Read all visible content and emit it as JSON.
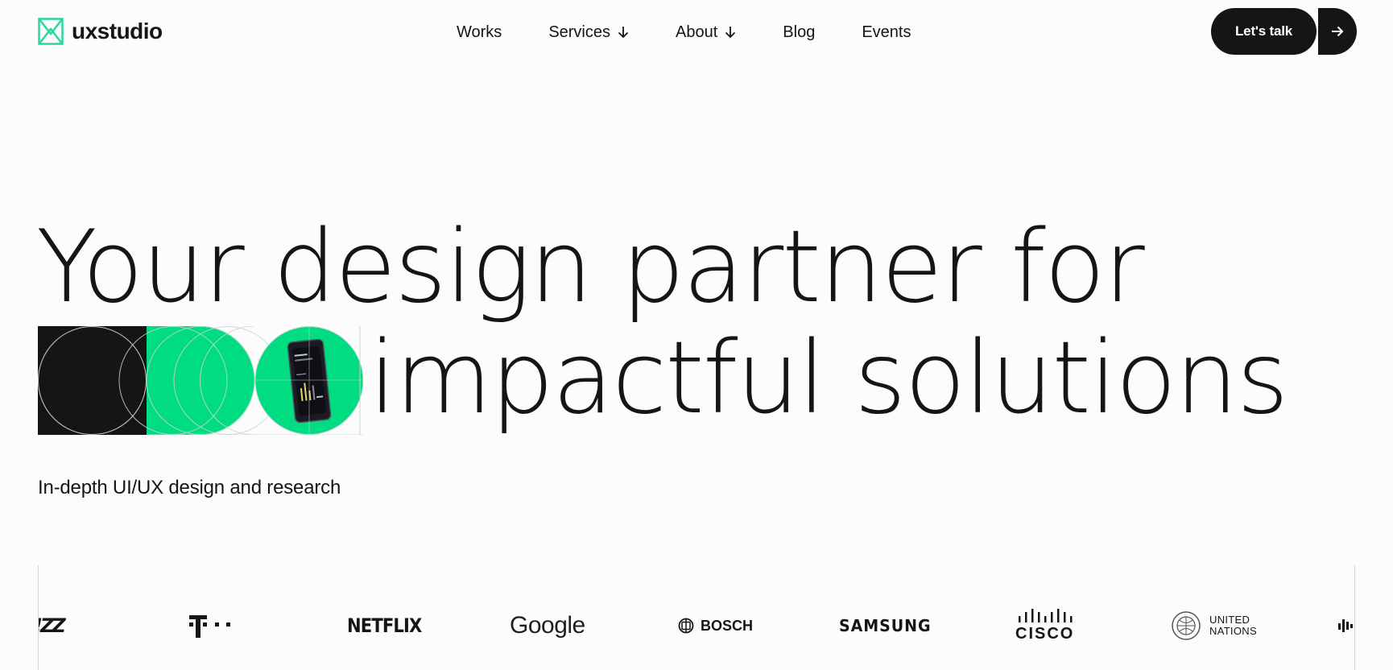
{
  "brand": {
    "name": "uxstudio",
    "accent": "#00dc82",
    "dark": "#151417"
  },
  "nav": {
    "items": [
      {
        "label": "Works",
        "has_dropdown": false
      },
      {
        "label": "Services",
        "has_dropdown": true
      },
      {
        "label": "About",
        "has_dropdown": true
      },
      {
        "label": "Blog",
        "has_dropdown": false
      },
      {
        "label": "Events",
        "has_dropdown": false
      }
    ]
  },
  "cta": {
    "label": "Let's talk",
    "icon": "arrow-right-icon"
  },
  "hero": {
    "line1": "Your design partner for",
    "line2": "impactful solutions",
    "subtitle": "In-depth UI/UX design and research"
  },
  "clients": {
    "partial_left": "!ZZ",
    "telekom": "T · · ·",
    "netflix": "NETFLIX",
    "google": "Google",
    "bosch": "BOSCH",
    "samsung": "SAMSUNG",
    "cisco": "CISCO",
    "un_line1": "UNITED",
    "un_line2": "NATIONS"
  }
}
